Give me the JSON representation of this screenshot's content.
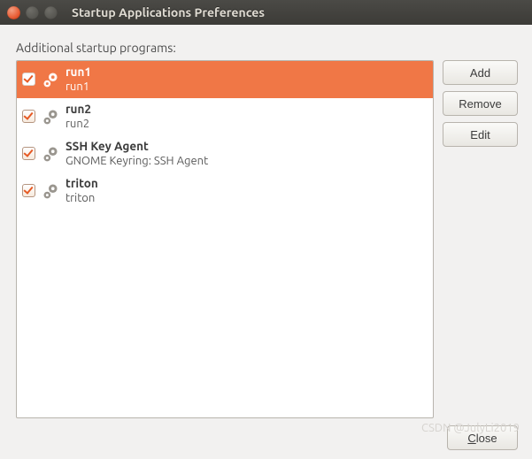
{
  "window": {
    "title": "Startup Applications Preferences"
  },
  "section_label": "Additional startup programs:",
  "programs": [
    {
      "name": "run1",
      "desc": "run1",
      "checked": true,
      "selected": true
    },
    {
      "name": "run2",
      "desc": "run2",
      "checked": true,
      "selected": false
    },
    {
      "name": "SSH Key Agent",
      "desc": "GNOME Keyring: SSH Agent",
      "checked": true,
      "selected": false
    },
    {
      "name": "triton",
      "desc": "triton",
      "checked": true,
      "selected": false
    }
  ],
  "buttons": {
    "add": "Add",
    "remove": "Remove",
    "edit": "Edit",
    "close": "Close"
  },
  "colors": {
    "accent": "#f07746"
  },
  "watermark": "CSDN @JulyLi2019"
}
